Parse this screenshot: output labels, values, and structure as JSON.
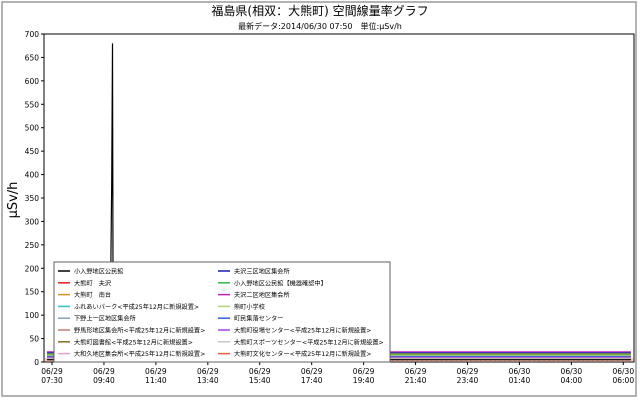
{
  "chart_data": {
    "type": "line",
    "title": "福島県(相双：大熊町) 空間線量率グラフ",
    "subtitle": "最新データ:2014/06/30 07:50　単位:μSv/h",
    "ylabel": "μSv/h",
    "xlabel": "",
    "ylim": [
      0,
      700
    ],
    "yticks": [
      0,
      50,
      100,
      150,
      200,
      250,
      300,
      350,
      400,
      450,
      500,
      550,
      600,
      650,
      700
    ],
    "grid": false,
    "legend_position": "bottom-left",
    "x_ticks": [
      {
        "date": "06/29",
        "time": "07:30"
      },
      {
        "date": "06/29",
        "time": "09:40"
      },
      {
        "date": "06/29",
        "time": "11:40"
      },
      {
        "date": "06/29",
        "time": "13:40"
      },
      {
        "date": "06/29",
        "time": "15:40"
      },
      {
        "date": "06/29",
        "time": "17:40"
      },
      {
        "date": "06/29",
        "time": "19:40"
      },
      {
        "date": "06/29",
        "time": "21:40"
      },
      {
        "date": "06/29",
        "time": "23:40"
      },
      {
        "date": "06/30",
        "time": "01:40"
      },
      {
        "date": "06/30",
        "time": "04:00"
      },
      {
        "date": "06/30",
        "time": "06:00"
      }
    ],
    "series": [
      {
        "name": "小入野地区公民館",
        "color": "#000000",
        "points": [
          [
            0,
            5
          ],
          [
            2.6,
            5
          ],
          [
            2.63,
            240
          ],
          [
            2.66,
            380
          ],
          [
            2.69,
            680
          ],
          [
            2.72,
            5
          ],
          [
            24,
            5
          ]
        ]
      },
      {
        "name": "大熊町　夫沢",
        "color": "#e02020",
        "points": [
          [
            0,
            18
          ],
          [
            24,
            18
          ]
        ]
      },
      {
        "name": "大熊町　南台",
        "color": "#e08a1a",
        "points": [
          [
            0,
            16
          ],
          [
            24,
            16
          ]
        ]
      },
      {
        "name": "ふれあいパーク<平成25年12月に新規設置>",
        "color": "#30c0c0",
        "points": [
          [
            0,
            13
          ],
          [
            24,
            13
          ]
        ]
      },
      {
        "name": "下野上一区地区集会所",
        "color": "#8fa0b0",
        "points": [
          [
            0,
            11
          ],
          [
            24,
            11
          ]
        ]
      },
      {
        "name": "野馬形地区集会所<平成25年12月に新規設置>",
        "color": "#c08080",
        "points": [
          [
            0,
            9
          ],
          [
            24,
            9
          ]
        ]
      },
      {
        "name": "大熊町図書館<平成25年12月に新規設置>",
        "color": "#807020",
        "points": [
          [
            0,
            7
          ],
          [
            24,
            7
          ]
        ]
      },
      {
        "name": "大和久地区集会所<平成25年12月に新規設置>",
        "color": "#e8a0c8",
        "points": [
          [
            0,
            6
          ],
          [
            24,
            6
          ]
        ]
      },
      {
        "name": "夫沢三区地区集会所",
        "color": "#1a1ab0",
        "points": [
          [
            0,
            20
          ],
          [
            24,
            20
          ]
        ]
      },
      {
        "name": "小入野地区公民館【機器確認中】",
        "color": "#20c040",
        "points": [
          [
            0,
            17
          ],
          [
            24,
            17
          ]
        ]
      },
      {
        "name": "夫沢二区地区集会所",
        "color": "#c020c0",
        "points": [
          [
            0,
            22
          ],
          [
            24,
            22
          ]
        ]
      },
      {
        "name": "熊町小学校",
        "color": "#b0d080",
        "points": [
          [
            0,
            14
          ],
          [
            24,
            14
          ]
        ]
      },
      {
        "name": "町民集落センター",
        "color": "#3060d0",
        "points": [
          [
            0,
            12
          ],
          [
            24,
            12
          ]
        ]
      },
      {
        "name": "大熊町役場センター<平成25年12月に新規設置>",
        "color": "#a040e0",
        "points": [
          [
            0,
            10
          ],
          [
            24,
            10
          ]
        ]
      },
      {
        "name": "大熊町スポーツセンター<平成25年12月に新規設置>",
        "color": "#c8c8c8",
        "points": [
          [
            0,
            8
          ],
          [
            24,
            8
          ]
        ]
      },
      {
        "name": "大熊町文化センター<平成25年12月に新規設置>",
        "color": "#f06040",
        "points": [
          [
            0,
            4
          ],
          [
            24,
            4
          ]
        ]
      }
    ]
  }
}
